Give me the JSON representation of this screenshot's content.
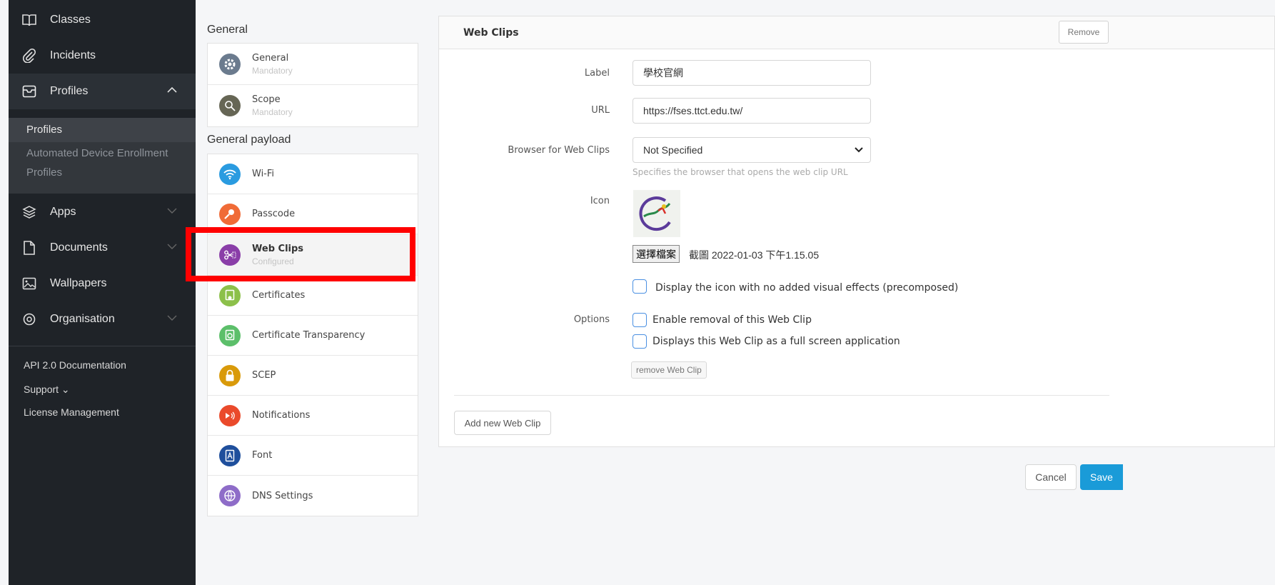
{
  "sidebar": {
    "items": [
      {
        "label": "Classes",
        "icon": "book-icon"
      },
      {
        "label": "Incidents",
        "icon": "paperclip-icon"
      },
      {
        "label": "Profiles",
        "icon": "inbox-icon",
        "expanded": true
      },
      {
        "label": "Apps",
        "icon": "layers-icon"
      },
      {
        "label": "Documents",
        "icon": "document-icon"
      },
      {
        "label": "Wallpapers",
        "icon": "image-icon"
      },
      {
        "label": "Organisation",
        "icon": "settings-icon"
      }
    ],
    "profiles_sub": {
      "selected": "Profiles",
      "ade_line1": "Automated Device Enrollment",
      "ade_line2": "Profiles"
    },
    "footer": {
      "api": "API 2.0 Documentation",
      "support": "Support ⌄",
      "license": "License Management"
    }
  },
  "payloads": {
    "general_title": "General",
    "general": [
      {
        "name": "General",
        "status": "Mandatory",
        "color": "#6b7b8e"
      },
      {
        "name": "Scope",
        "status": "Mandatory",
        "color": "#666655"
      }
    ],
    "payload_title": "General payload",
    "items": [
      {
        "name": "Wi-Fi",
        "status": "",
        "color": "#2a9be0"
      },
      {
        "name": "Passcode",
        "status": "",
        "color": "#f06b37"
      },
      {
        "name": "Web Clips",
        "status": "Configured",
        "color": "#8a3ea8",
        "selected": true
      },
      {
        "name": "Certificates",
        "status": "",
        "color": "#8cc04a"
      },
      {
        "name": "Certificate Transparency",
        "status": "",
        "color": "#5cbf6a"
      },
      {
        "name": "SCEP",
        "status": "",
        "color": "#d99a0a"
      },
      {
        "name": "Notifications",
        "status": "",
        "color": "#ea4a2b"
      },
      {
        "name": "Font",
        "status": "",
        "color": "#1f4f9c"
      },
      {
        "name": "DNS Settings",
        "status": "",
        "color": "#8e6cc8"
      }
    ]
  },
  "panel": {
    "title": "Web Clips",
    "remove_label": "Remove",
    "label_field": {
      "label": "Label",
      "value": "學校官網"
    },
    "url_field": {
      "label": "URL",
      "value": "https://fses.ttct.edu.tw/"
    },
    "browser_field": {
      "label": "Browser for Web Clips",
      "value": "Not Specified",
      "help": "Specifies the browser that opens the web clip URL"
    },
    "icon_field": {
      "label": "Icon",
      "file_button": "選擇檔案",
      "file_name": "截圖 2022-01-03 下午1.15.05"
    },
    "precomposed_label": "Display the icon with no added visual effects (precomposed)",
    "options_label": "Options",
    "option1": "Enable removal of this Web Clip",
    "option2": "Displays this Web Clip as a full screen application",
    "remove_clip_label": "remove Web Clip",
    "add_label": "Add new Web Clip"
  },
  "actions": {
    "cancel": "Cancel",
    "save": "Save"
  }
}
